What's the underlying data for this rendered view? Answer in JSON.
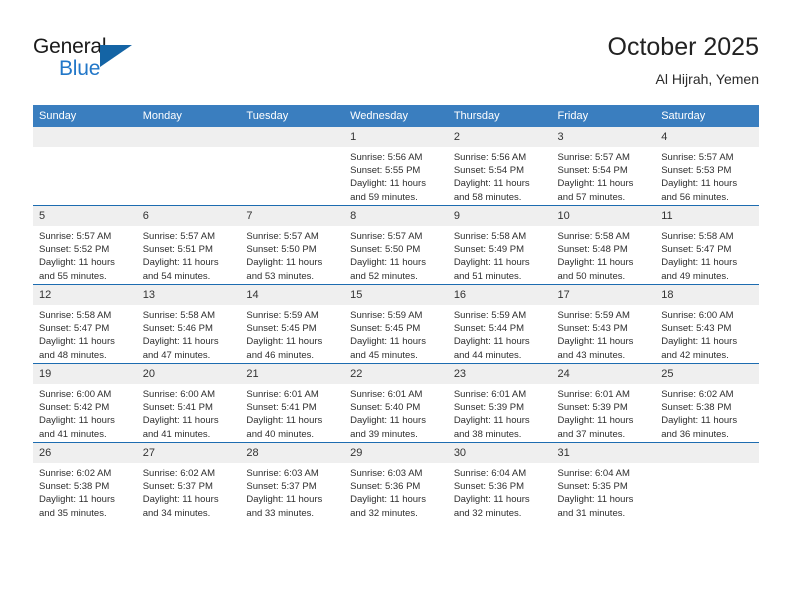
{
  "brand": {
    "word1": "General",
    "word2": "Blue",
    "triangle_color": "#1464a5",
    "blue_color": "#2277c8"
  },
  "header": {
    "title": "October 2025",
    "subtitle": "Al Hijrah, Yemen"
  },
  "theme": {
    "header_row_bg": "#3a7ebf",
    "day_strip_bg": "#efefef",
    "row_divider": "#1d6cb0"
  },
  "weekdays": [
    "Sunday",
    "Monday",
    "Tuesday",
    "Wednesday",
    "Thursday",
    "Friday",
    "Saturday"
  ],
  "weeks": [
    [
      {
        "day": "",
        "empty": true
      },
      {
        "day": "",
        "empty": true
      },
      {
        "day": "",
        "empty": true
      },
      {
        "day": "1",
        "sunrise": "Sunrise: 5:56 AM",
        "sunset": "Sunset: 5:55 PM",
        "daylight": "Daylight: 11 hours and 59 minutes."
      },
      {
        "day": "2",
        "sunrise": "Sunrise: 5:56 AM",
        "sunset": "Sunset: 5:54 PM",
        "daylight": "Daylight: 11 hours and 58 minutes."
      },
      {
        "day": "3",
        "sunrise": "Sunrise: 5:57 AM",
        "sunset": "Sunset: 5:54 PM",
        "daylight": "Daylight: 11 hours and 57 minutes."
      },
      {
        "day": "4",
        "sunrise": "Sunrise: 5:57 AM",
        "sunset": "Sunset: 5:53 PM",
        "daylight": "Daylight: 11 hours and 56 minutes."
      }
    ],
    [
      {
        "day": "5",
        "sunrise": "Sunrise: 5:57 AM",
        "sunset": "Sunset: 5:52 PM",
        "daylight": "Daylight: 11 hours and 55 minutes."
      },
      {
        "day": "6",
        "sunrise": "Sunrise: 5:57 AM",
        "sunset": "Sunset: 5:51 PM",
        "daylight": "Daylight: 11 hours and 54 minutes."
      },
      {
        "day": "7",
        "sunrise": "Sunrise: 5:57 AM",
        "sunset": "Sunset: 5:50 PM",
        "daylight": "Daylight: 11 hours and 53 minutes."
      },
      {
        "day": "8",
        "sunrise": "Sunrise: 5:57 AM",
        "sunset": "Sunset: 5:50 PM",
        "daylight": "Daylight: 11 hours and 52 minutes."
      },
      {
        "day": "9",
        "sunrise": "Sunrise: 5:58 AM",
        "sunset": "Sunset: 5:49 PM",
        "daylight": "Daylight: 11 hours and 51 minutes."
      },
      {
        "day": "10",
        "sunrise": "Sunrise: 5:58 AM",
        "sunset": "Sunset: 5:48 PM",
        "daylight": "Daylight: 11 hours and 50 minutes."
      },
      {
        "day": "11",
        "sunrise": "Sunrise: 5:58 AM",
        "sunset": "Sunset: 5:47 PM",
        "daylight": "Daylight: 11 hours and 49 minutes."
      }
    ],
    [
      {
        "day": "12",
        "sunrise": "Sunrise: 5:58 AM",
        "sunset": "Sunset: 5:47 PM",
        "daylight": "Daylight: 11 hours and 48 minutes."
      },
      {
        "day": "13",
        "sunrise": "Sunrise: 5:58 AM",
        "sunset": "Sunset: 5:46 PM",
        "daylight": "Daylight: 11 hours and 47 minutes."
      },
      {
        "day": "14",
        "sunrise": "Sunrise: 5:59 AM",
        "sunset": "Sunset: 5:45 PM",
        "daylight": "Daylight: 11 hours and 46 minutes."
      },
      {
        "day": "15",
        "sunrise": "Sunrise: 5:59 AM",
        "sunset": "Sunset: 5:45 PM",
        "daylight": "Daylight: 11 hours and 45 minutes."
      },
      {
        "day": "16",
        "sunrise": "Sunrise: 5:59 AM",
        "sunset": "Sunset: 5:44 PM",
        "daylight": "Daylight: 11 hours and 44 minutes."
      },
      {
        "day": "17",
        "sunrise": "Sunrise: 5:59 AM",
        "sunset": "Sunset: 5:43 PM",
        "daylight": "Daylight: 11 hours and 43 minutes."
      },
      {
        "day": "18",
        "sunrise": "Sunrise: 6:00 AM",
        "sunset": "Sunset: 5:43 PM",
        "daylight": "Daylight: 11 hours and 42 minutes."
      }
    ],
    [
      {
        "day": "19",
        "sunrise": "Sunrise: 6:00 AM",
        "sunset": "Sunset: 5:42 PM",
        "daylight": "Daylight: 11 hours and 41 minutes."
      },
      {
        "day": "20",
        "sunrise": "Sunrise: 6:00 AM",
        "sunset": "Sunset: 5:41 PM",
        "daylight": "Daylight: 11 hours and 41 minutes."
      },
      {
        "day": "21",
        "sunrise": "Sunrise: 6:01 AM",
        "sunset": "Sunset: 5:41 PM",
        "daylight": "Daylight: 11 hours and 40 minutes."
      },
      {
        "day": "22",
        "sunrise": "Sunrise: 6:01 AM",
        "sunset": "Sunset: 5:40 PM",
        "daylight": "Daylight: 11 hours and 39 minutes."
      },
      {
        "day": "23",
        "sunrise": "Sunrise: 6:01 AM",
        "sunset": "Sunset: 5:39 PM",
        "daylight": "Daylight: 11 hours and 38 minutes."
      },
      {
        "day": "24",
        "sunrise": "Sunrise: 6:01 AM",
        "sunset": "Sunset: 5:39 PM",
        "daylight": "Daylight: 11 hours and 37 minutes."
      },
      {
        "day": "25",
        "sunrise": "Sunrise: 6:02 AM",
        "sunset": "Sunset: 5:38 PM",
        "daylight": "Daylight: 11 hours and 36 minutes."
      }
    ],
    [
      {
        "day": "26",
        "sunrise": "Sunrise: 6:02 AM",
        "sunset": "Sunset: 5:38 PM",
        "daylight": "Daylight: 11 hours and 35 minutes."
      },
      {
        "day": "27",
        "sunrise": "Sunrise: 6:02 AM",
        "sunset": "Sunset: 5:37 PM",
        "daylight": "Daylight: 11 hours and 34 minutes."
      },
      {
        "day": "28",
        "sunrise": "Sunrise: 6:03 AM",
        "sunset": "Sunset: 5:37 PM",
        "daylight": "Daylight: 11 hours and 33 minutes."
      },
      {
        "day": "29",
        "sunrise": "Sunrise: 6:03 AM",
        "sunset": "Sunset: 5:36 PM",
        "daylight": "Daylight: 11 hours and 32 minutes."
      },
      {
        "day": "30",
        "sunrise": "Sunrise: 6:04 AM",
        "sunset": "Sunset: 5:36 PM",
        "daylight": "Daylight: 11 hours and 32 minutes."
      },
      {
        "day": "31",
        "sunrise": "Sunrise: 6:04 AM",
        "sunset": "Sunset: 5:35 PM",
        "daylight": "Daylight: 11 hours and 31 minutes."
      },
      {
        "day": "",
        "empty": true
      }
    ]
  ]
}
